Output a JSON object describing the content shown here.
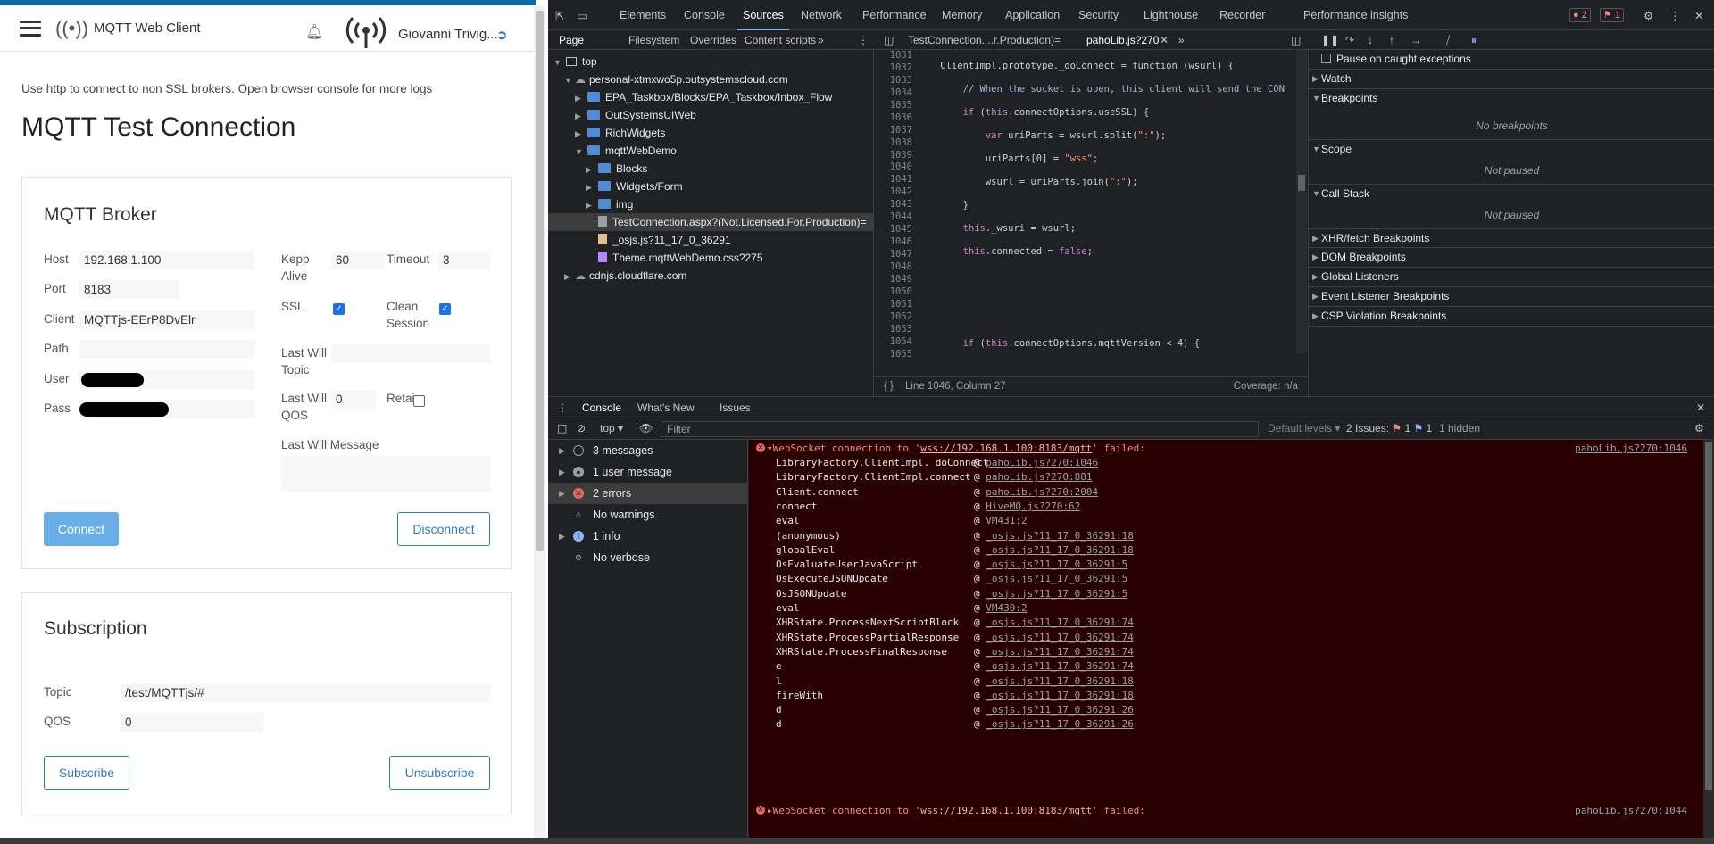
{
  "app": {
    "title": "MQTT Web Client",
    "user_name": "Giovanni Trivig...",
    "note": "Use http to connect to non SSL brokers. Open browser console for more logs",
    "page_title": "MQTT Test Connection",
    "broker": {
      "heading": "MQTT Broker",
      "host_label": "Host",
      "host_value": "192.168.1.100",
      "port_label": "Port",
      "port_value": "8183",
      "client_label": "Client",
      "client_value": "MQTTjs-EErP8DvElr",
      "path_label": "Path",
      "path_value": "",
      "user_label": "User",
      "pass_label": "Pass",
      "keepalive_label_1": "Kepp",
      "keepalive_label_2": "Alive",
      "keepalive_value": "60",
      "timeout_label": "Timeout",
      "timeout_value": "3",
      "ssl_label": "SSL",
      "ssl_checked": true,
      "clean_label_1": "Clean",
      "clean_label_2": "Session",
      "clean_checked": true,
      "lastwill_topic_label_1": "Last Will",
      "lastwill_topic_label_2": "Topic",
      "lastwill_topic_value": "",
      "lastwill_qos_label_1": "Last Will",
      "lastwill_qos_label_2": "QOS",
      "lastwill_qos_value": "0",
      "retain_label": "Retai",
      "retain_checked": false,
      "lastwill_message_label": "Last Will Message",
      "connect_label": "Connect",
      "disconnect_label": "Disconnect"
    },
    "subscription": {
      "heading": "Subscription",
      "topic_label": "Topic",
      "topic_value": "/test/MQTTjs/#",
      "qos_label": "QOS",
      "qos_value": "0",
      "subscribe_label": "Subscribe",
      "unsubscribe_label": "Unsubscribe"
    }
  },
  "devtools": {
    "main_tabs": [
      "Elements",
      "Console",
      "Sources",
      "Network",
      "Performance",
      "Memory",
      "Application",
      "Security",
      "Lighthouse",
      "Recorder",
      "Performance insights"
    ],
    "active_main_tab": "Sources",
    "error_badge": "2",
    "issue_badge": "1",
    "nav_tabs": [
      "Page",
      "Filesystem",
      "Overrides",
      "Content scripts"
    ],
    "editor_tabs": [
      "TestConnection....r.Production)=",
      "pahoLib.js?270"
    ],
    "tree": {
      "top": "top",
      "domain": "personal-xtmxwo5p.outsystemscloud.com",
      "items": [
        "EPA_Taskbox/Blocks/EPA_Taskbox/Inbox_Flow",
        "OutSystemsUIWeb",
        "RichWidgets",
        "mqttWebDemo",
        "Blocks",
        "Widgets/Form",
        "img",
        "TestConnection.aspx?(Not.Licensed.For.Production)=",
        "_osjs.js?11_17_0_36291",
        "Theme.mqttWebDemo.css?275",
        "cdnjs.cloudflare.com"
      ]
    },
    "code_lines": {
      "numbers": [
        "1031",
        "1032",
        "1033",
        "1034",
        "1035",
        "1036",
        "1037",
        "1038",
        "1039",
        "1040",
        "1041",
        "1042",
        "1043",
        "1044",
        "1045",
        "1046",
        "1047",
        "1048",
        "1049",
        "1050",
        "1051",
        "1052",
        "1053",
        "1054",
        "1055"
      ]
    },
    "status": {
      "position": "Line 1046, Column 27",
      "coverage": "Coverage: n/a"
    },
    "debugger": {
      "pause_caught": "Pause on caught exceptions",
      "watch": "Watch",
      "breakpoints": "Breakpoints",
      "no_breakpoints": "No breakpoints",
      "scope": "Scope",
      "not_paused_1": "Not paused",
      "call_stack": "Call Stack",
      "not_paused_2": "Not paused",
      "xhr": "XHR/fetch Breakpoints",
      "dom": "DOM Breakpoints",
      "global": "Global Listeners",
      "event": "Event Listener Breakpoints",
      "csp": "CSP Violation Breakpoints"
    },
    "drawer_tabs": [
      "Console",
      "What's New",
      "Issues"
    ],
    "console_toolbar": {
      "context": "top",
      "filter_placeholder": "Filter",
      "levels": "Default levels",
      "issues": "2 Issues:",
      "issues_err": "1",
      "issues_warn": "1",
      "hidden": "1 hidden"
    },
    "console_sidebar": [
      "3 messages",
      "1 user message",
      "2 errors",
      "No warnings",
      "1 info",
      "No verbose"
    ],
    "error1": {
      "prefix": "WebSocket connection to '",
      "url": "wss://192.168.1.100:8183/mqtt",
      "suffix": "' failed:",
      "source": "pahoLib.js?270:1046"
    },
    "stack": [
      [
        "LibraryFactory.ClientImpl._doConnect",
        "pahoLib.js?270:1046"
      ],
      [
        "LibraryFactory.ClientImpl.connect",
        "pahoLib.js?270:881"
      ],
      [
        "Client.connect",
        "pahoLib.js?270:2004"
      ],
      [
        "connect",
        "HiveMQ.js?270:62"
      ],
      [
        "eval",
        "VM431:2"
      ],
      [
        "(anonymous)",
        "_osjs.js?11_17_0_36291:18"
      ],
      [
        "globalEval",
        "_osjs.js?11_17_0_36291:18"
      ],
      [
        "OsEvaluateUserJavaScript",
        "_osjs.js?11_17_0_36291:5"
      ],
      [
        "OsExecuteJSONUpdate",
        "_osjs.js?11_17_0_36291:5"
      ],
      [
        "OsJSONUpdate",
        "_osjs.js?11_17_0_36291:5"
      ],
      [
        "eval",
        "VM430:2"
      ],
      [
        "XHRState.ProcessNextScriptBlock",
        "_osjs.js?11_17_0_36291:74"
      ],
      [
        "XHRState.ProcessPartialResponse",
        "_osjs.js?11_17_0_36291:74"
      ],
      [
        "XHRState.ProcessFinalResponse",
        "_osjs.js?11_17_0_36291:74"
      ],
      [
        "e",
        "_osjs.js?11_17_0_36291:74"
      ],
      [
        "l",
        "_osjs.js?11_17_0_36291:18"
      ],
      [
        "fireWith",
        "_osjs.js?11_17_0_36291:18"
      ],
      [
        "d",
        "_osjs.js?11_17_0_36291:26"
      ],
      [
        "d",
        "_osjs.js?11_17_0_36291:26"
      ]
    ],
    "error2": {
      "prefix": "WebSocket connection to '",
      "url": "wss://192.168.1.100:8183/mqtt",
      "suffix": "' failed:",
      "source": "pahoLib.js?270:1044"
    }
  }
}
